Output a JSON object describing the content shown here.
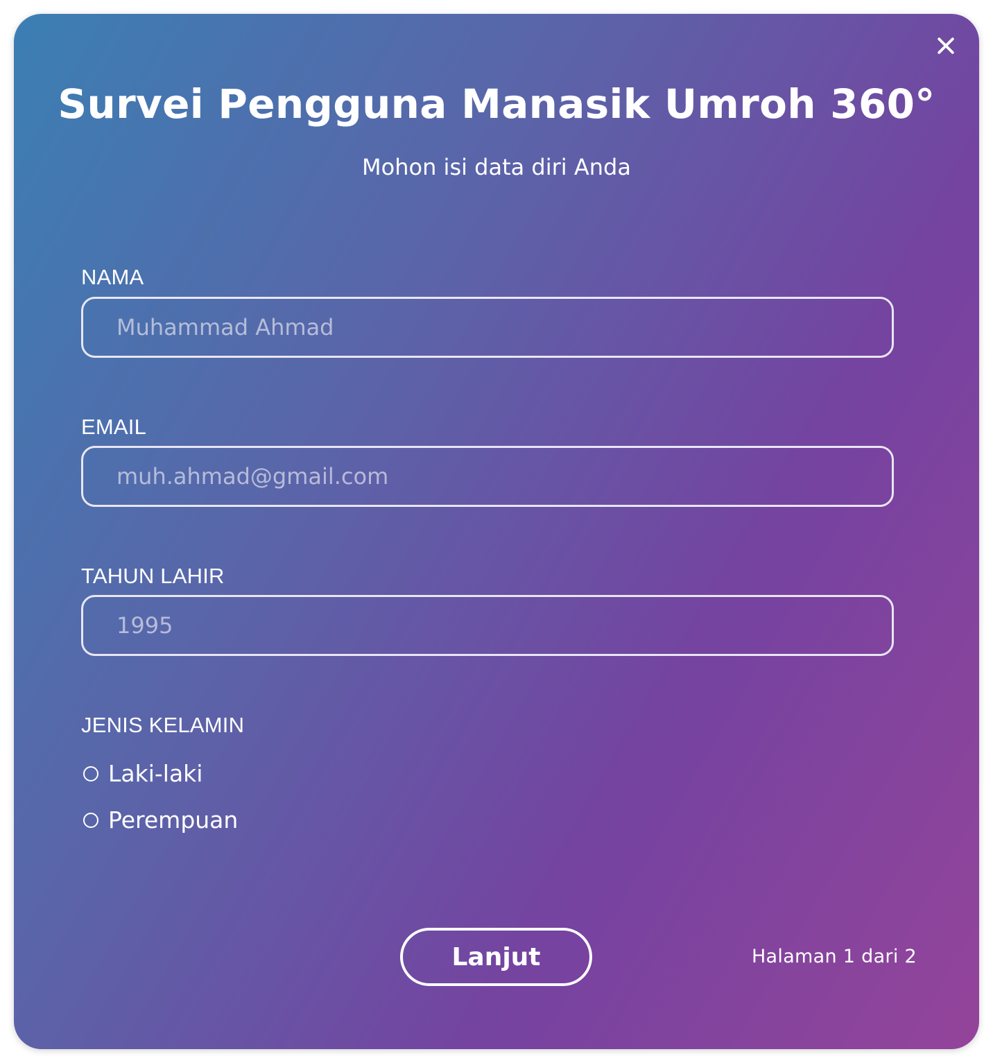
{
  "dialog": {
    "title": "Survei Pengguna Manasik Umroh 360°",
    "subtitle": "Mohon isi data diri Anda",
    "close_icon": "close-icon"
  },
  "fields": {
    "name": {
      "label": "NAMA",
      "placeholder": "Muhammad Ahmad"
    },
    "email": {
      "label": "EMAIL",
      "placeholder": "muh.ahmad@gmail.com"
    },
    "birth_year": {
      "label": "TAHUN LAHIR",
      "placeholder": "1995"
    }
  },
  "gender": {
    "label": "JENIS KELAMIN",
    "options": [
      "Laki-laki",
      "Perempuan"
    ]
  },
  "footer": {
    "next_label": "Lanjut",
    "page_indicator": "Halaman 1 dari 2"
  },
  "colors": {
    "gradient_start": "#3b7fb3",
    "gradient_mid": "#7543a0",
    "gradient_end": "#94449a",
    "text": "#ffffff"
  }
}
